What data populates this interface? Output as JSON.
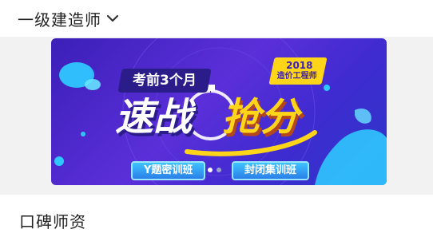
{
  "header": {
    "title": "一级建造师",
    "dropdown_icon": "chevron-down-icon"
  },
  "banner": {
    "subtitle": "考前3个月",
    "year": "2018",
    "tag_label": "造价工程师",
    "headline_left": "速战",
    "headline_right": "抢分",
    "buttons": [
      "Y题密训班",
      "封闭集训班"
    ],
    "carousel": {
      "count": 2,
      "active": 0
    },
    "colors": {
      "background": "#4a2bd4",
      "accent": "#ffd51a",
      "button": "#36a4f4"
    }
  },
  "section": {
    "title": "口碑师资"
  }
}
